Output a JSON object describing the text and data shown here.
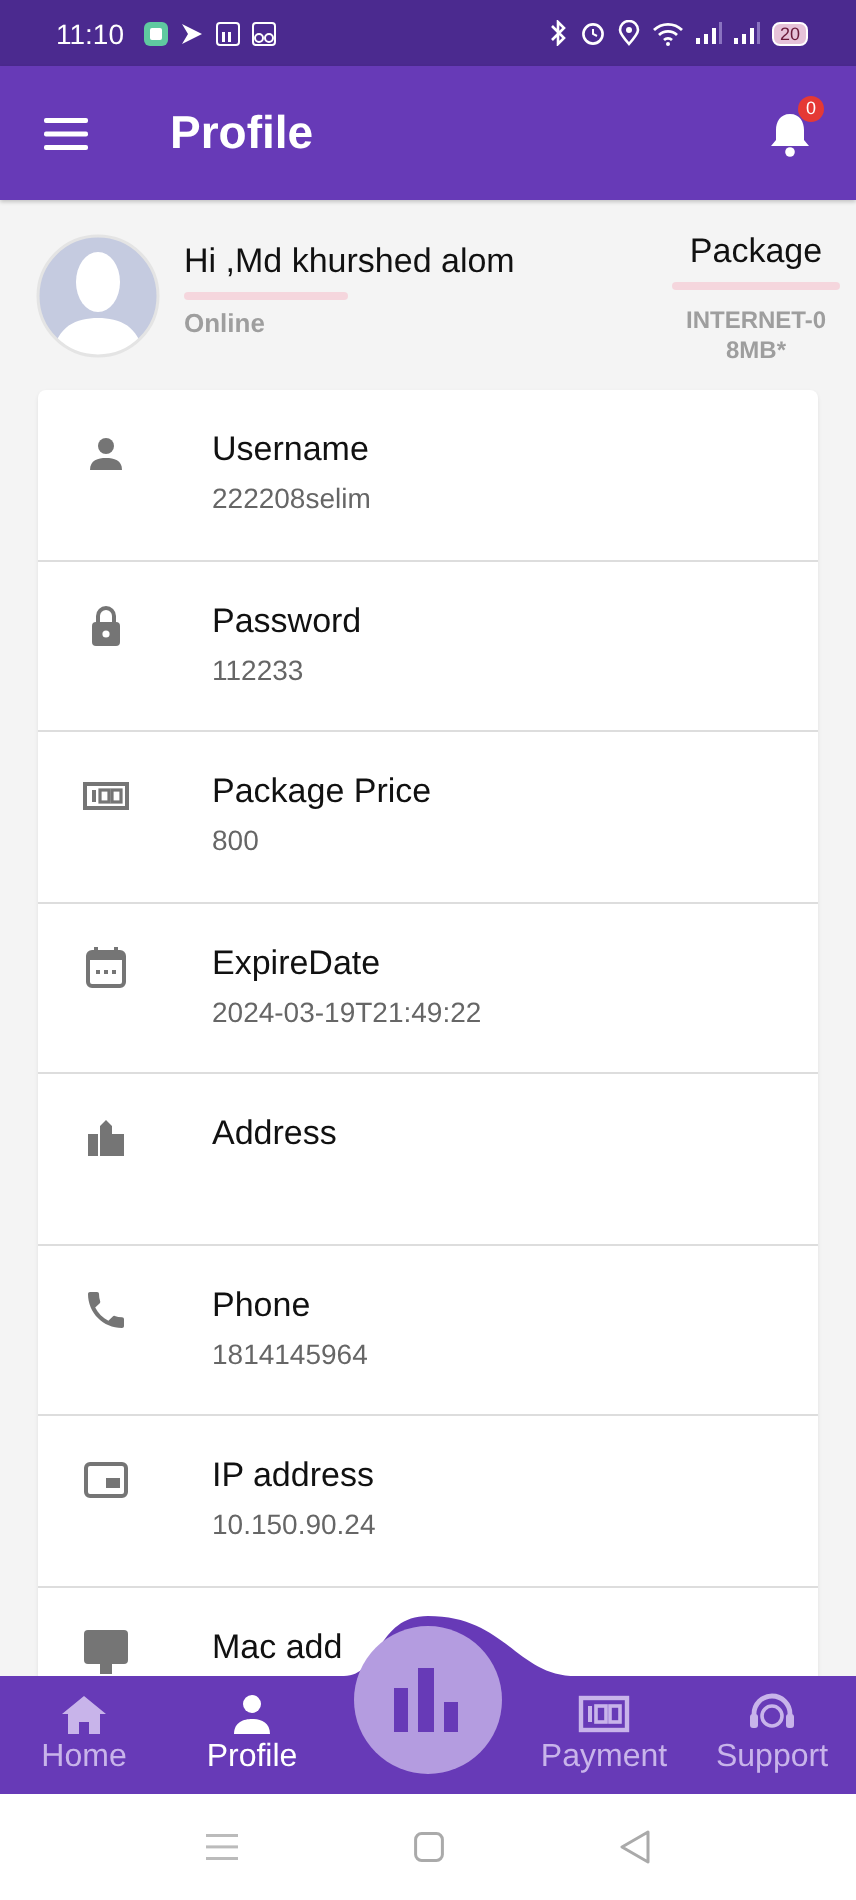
{
  "status_bar": {
    "time": "11:10",
    "battery": "20"
  },
  "app_bar": {
    "title": "Profile",
    "notification_count": "0"
  },
  "profile": {
    "greeting": "Hi ,Md khurshed alom",
    "status": "Online",
    "package_label": "Package",
    "package_name": "INTERNET-08MB*"
  },
  "fields": [
    {
      "label": "Username",
      "value": "222208selim"
    },
    {
      "label": "Password",
      "value": "112233"
    },
    {
      "label": "Package Price",
      "value": "800"
    },
    {
      "label": "ExpireDate",
      "value": "2024-03-19T21:49:22"
    },
    {
      "label": "Address"
    },
    {
      "label": "Phone",
      "value": "1814145964"
    },
    {
      "label": "IP address",
      "value": "10.150.90.24"
    },
    {
      "label": "Mac add"
    }
  ],
  "bottom_nav": [
    {
      "label": "Home",
      "selected": false
    },
    {
      "label": "Profile",
      "selected": true
    },
    {
      "label": "Payment",
      "selected": false
    },
    {
      "label": "Support",
      "selected": false
    }
  ]
}
